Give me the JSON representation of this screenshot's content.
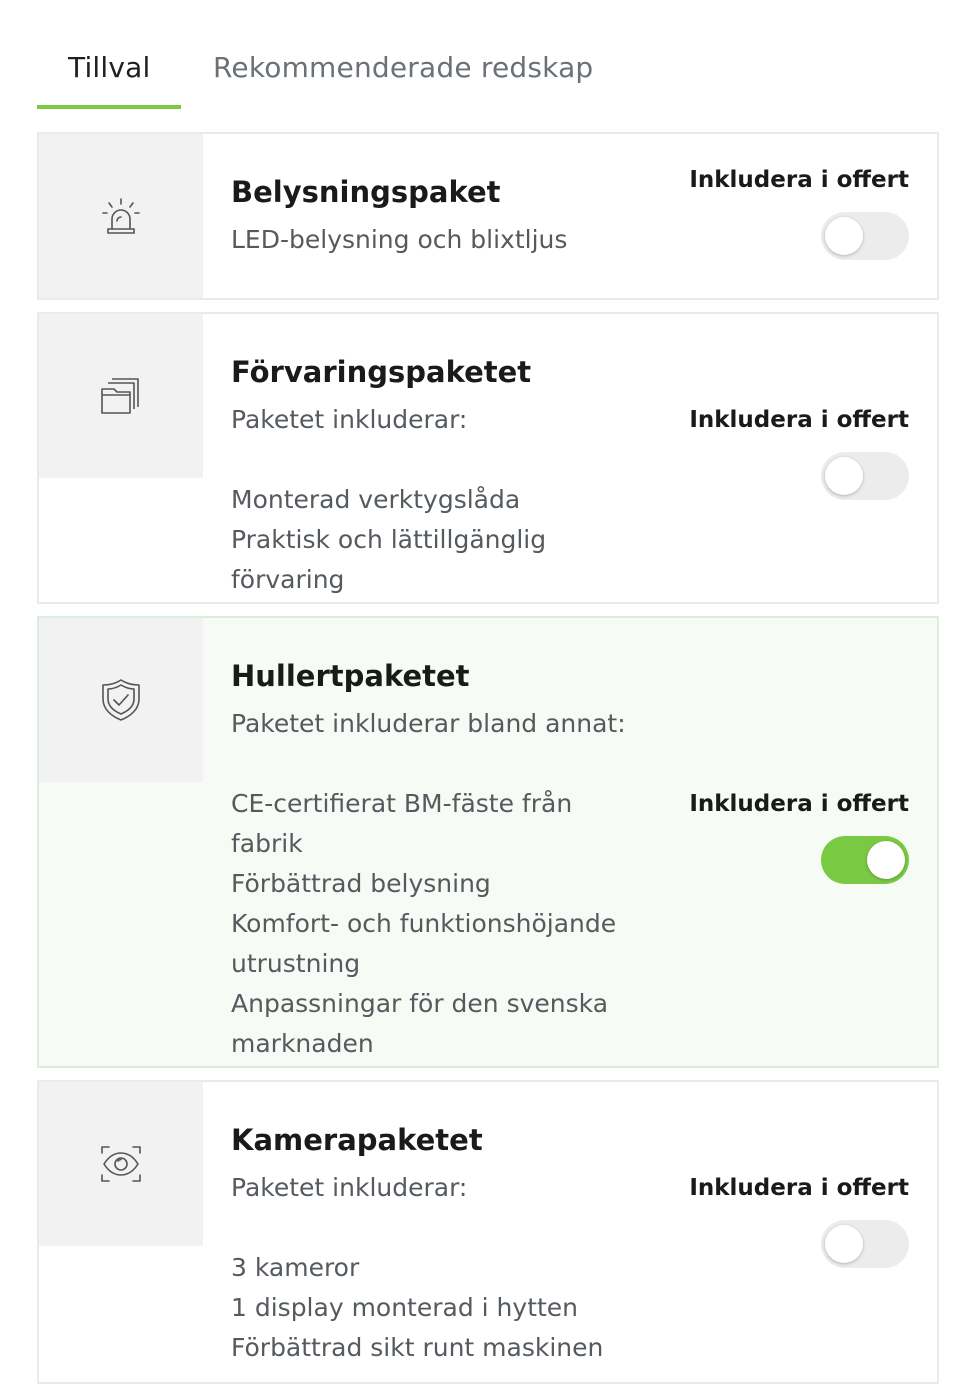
{
  "tabs": [
    {
      "label": "Tillval",
      "active": true
    },
    {
      "label": "Rekommenderade redskap",
      "active": false
    }
  ],
  "accent_color": "#7ac943",
  "cards": [
    {
      "title": "Belysningspaket",
      "subtitle": "LED-belysning och blixtljus",
      "items": [],
      "icon": "beacon-light-icon",
      "action_label": "Inkludera i offert",
      "included": false
    },
    {
      "title": "Förvaringspaketet",
      "subtitle": "Paketet inkluderar:",
      "items": [
        "Monterad verktygslåda",
        "Praktisk och lättillgänglig",
        "förvaring"
      ],
      "icon": "folder-stack-icon",
      "action_label": "Inkludera i offert",
      "included": false
    },
    {
      "title": "Hullertpaketet",
      "subtitle": "Paketet inkluderar bland annat:",
      "items": [
        "CE-certifierat BM-fäste från",
        "fabrik",
        "Förbättrad belysning",
        "Komfort- och funktionshöjande",
        "utrustning",
        "Anpassningar för den svenska",
        "marknaden"
      ],
      "icon": "shield-check-icon",
      "action_label": "Inkludera i offert",
      "included": true
    },
    {
      "title": "Kamerapaketet",
      "subtitle": "Paketet inkluderar:",
      "items": [
        "3 kameror",
        "1 display monterad i hytten",
        "Förbättrad sikt runt maskinen"
      ],
      "icon": "camera-eye-icon",
      "action_label": "Inkludera i offert",
      "included": false
    }
  ]
}
